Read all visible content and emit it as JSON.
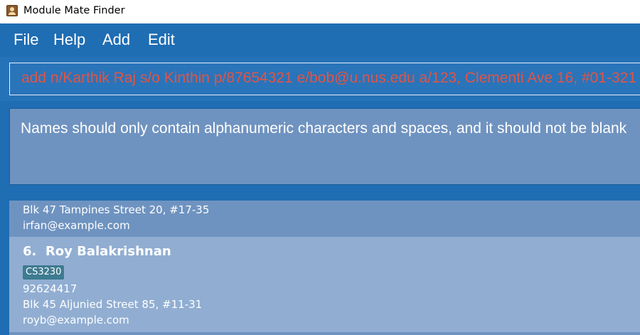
{
  "window": {
    "title": "Module Mate Finder",
    "icon": "contact-book-icon"
  },
  "menu": {
    "items": [
      "File",
      "Help",
      "Add",
      "Edit"
    ]
  },
  "command": {
    "value": "add n/Karthik Raj s/o Kinthin p/87654321 e/bob@u.nus.edu a/123, Clementi Ave 16, #01-321",
    "text_color": "#e05545"
  },
  "result": {
    "message": "Names should only contain alphanumeric characters and spaces, and it should not be blank"
  },
  "person_list": {
    "previous_card": {
      "address": "Blk 47 Tampines Street 20, #17-35",
      "email": "irfan@example.com"
    },
    "selected_card": {
      "index": "6.",
      "name": "Roy Balakrishnan",
      "tags": [
        "CS3230"
      ],
      "phone": "92624417",
      "address": "Blk 45 Aljunied Street 85, #11-31",
      "email": "royb@example.com"
    }
  },
  "colors": {
    "background": "#1f6db3",
    "panel": "#6f93c0",
    "selected_card": "#91aed2",
    "tag": "#3e7b91"
  }
}
